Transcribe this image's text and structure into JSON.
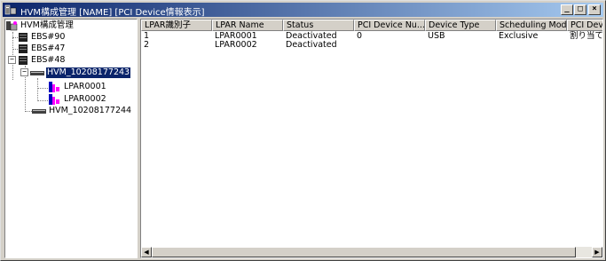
{
  "window": {
    "title": "HVM構成管理 [NAME] [PCI Device情報表示]",
    "minimize_glyph": "_",
    "maximize_glyph": "□",
    "close_glyph": "×"
  },
  "tree": {
    "root": {
      "label": "HVM構成管理",
      "icon": "hvm-root-icon"
    },
    "items": [
      {
        "label": "EBS#90",
        "icon": "server-icon"
      },
      {
        "label": "EBS#47",
        "icon": "server-icon"
      },
      {
        "label": "EBS#48",
        "icon": "server-icon",
        "expander": "−"
      },
      {
        "label": "HVM_10208177243",
        "icon": "hvm-icon",
        "expander": "−",
        "selected": true
      },
      {
        "label": "LPAR0001",
        "icon": "lpar-icon"
      },
      {
        "label": "LPAR0002",
        "icon": "lpar-icon"
      },
      {
        "label": "HVM_10208177244",
        "icon": "hvm-icon"
      }
    ]
  },
  "table": {
    "columns": [
      "LPAR識別子",
      "LPAR Name",
      "Status",
      "PCI Device Nu...",
      "Device Type",
      "Scheduling Mode",
      "PCI Devi"
    ],
    "rows": [
      [
        "1",
        "LPAR0001",
        "Deactivated",
        "0",
        "USB",
        "Exclusive",
        "割り当て時"
      ],
      [
        "2",
        "LPAR0002",
        "Deactivated",
        "",
        "",
        "",
        ""
      ]
    ]
  },
  "scrollbar": {
    "left_glyph": "◀",
    "right_glyph": "▶"
  }
}
